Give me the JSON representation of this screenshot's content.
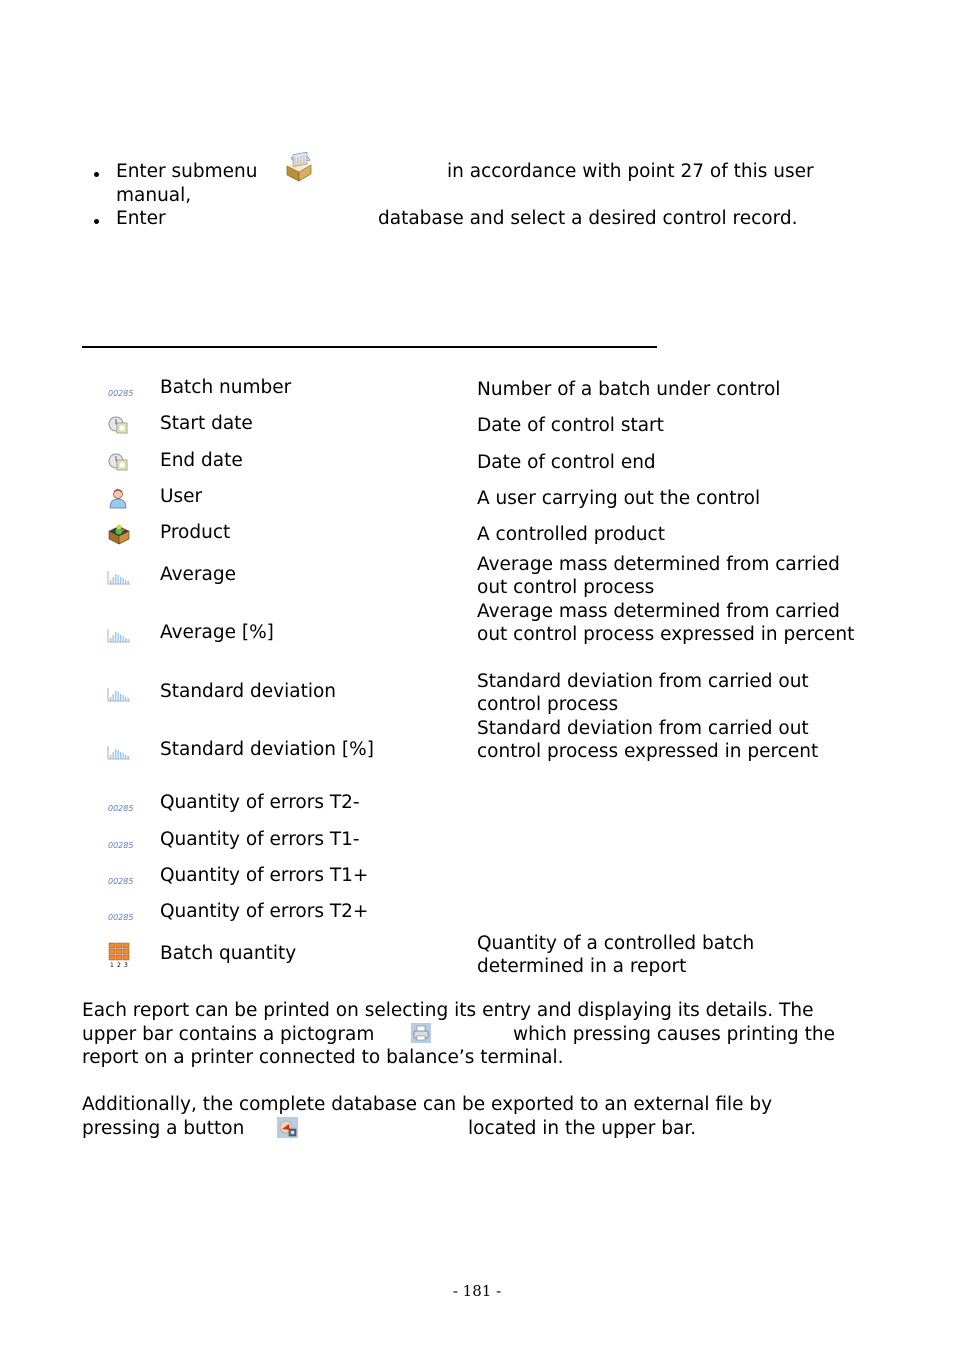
{
  "instructions": {
    "items": [
      {
        "before": "Enter submenu",
        "after": "in accordance with point 27 of this user",
        "continuation": "manual,",
        "icon": "database-box-icon"
      },
      {
        "before": "Enter",
        "after": "database and select a desired control record."
      }
    ]
  },
  "table": {
    "rows": [
      {
        "icon": "number-field-icon",
        "label": "Batch number",
        "desc": "Number of a batch under control"
      },
      {
        "icon": "date-icon",
        "label": "Start date",
        "desc": "Date of control start"
      },
      {
        "icon": "date-icon",
        "label": "End date",
        "desc": "Date of control end"
      },
      {
        "icon": "user-icon",
        "label": "User",
        "desc": "A user carrying out the control"
      },
      {
        "icon": "product-icon",
        "label": "Product",
        "desc": "A controlled product"
      },
      {
        "icon": "statistics-icon",
        "label": "Average",
        "desc": "Average mass determined from carried out control process"
      },
      {
        "icon": "statistics-icon",
        "label": "Average [%]",
        "desc": "Average mass determined from carried out control process expressed in percent"
      },
      {
        "icon": "statistics-icon",
        "label": "Standard deviation",
        "desc": "Standard deviation from carried out control process"
      },
      {
        "icon": "statistics-icon",
        "label": "Standard deviation [%]",
        "desc": "Standard deviation from carried out control process expressed in percent"
      },
      {
        "icon": "number-field-icon",
        "label": "Quantity of errors T2-",
        "desc": ""
      },
      {
        "icon": "number-field-icon",
        "label": "Quantity of errors T1-",
        "desc": ""
      },
      {
        "icon": "number-field-icon",
        "label": "Quantity of errors T1+",
        "desc": ""
      },
      {
        "icon": "number-field-icon",
        "label": "Quantity of errors T2+",
        "desc": ""
      },
      {
        "icon": "batch-quantity-icon",
        "label": "Batch quantity",
        "desc": "Quantity of a controlled batch determined in a report"
      }
    ]
  },
  "print_paragraph": {
    "line1": "Each report can be printed on selecting its entry and displaying its details. The",
    "line2_before": "upper bar contains a pictogram",
    "line2_after": "which pressing causes printing the",
    "line3": "report on a printer connected to balance’s terminal."
  },
  "export_paragraph": {
    "line1": "Additionally, the complete database can be exported to an external file by",
    "line2_before": "pressing a button",
    "line2_after": "located in the upper bar."
  },
  "icon_text": {
    "number_field": "00285"
  },
  "footer": {
    "page_number": "- 181 -"
  }
}
